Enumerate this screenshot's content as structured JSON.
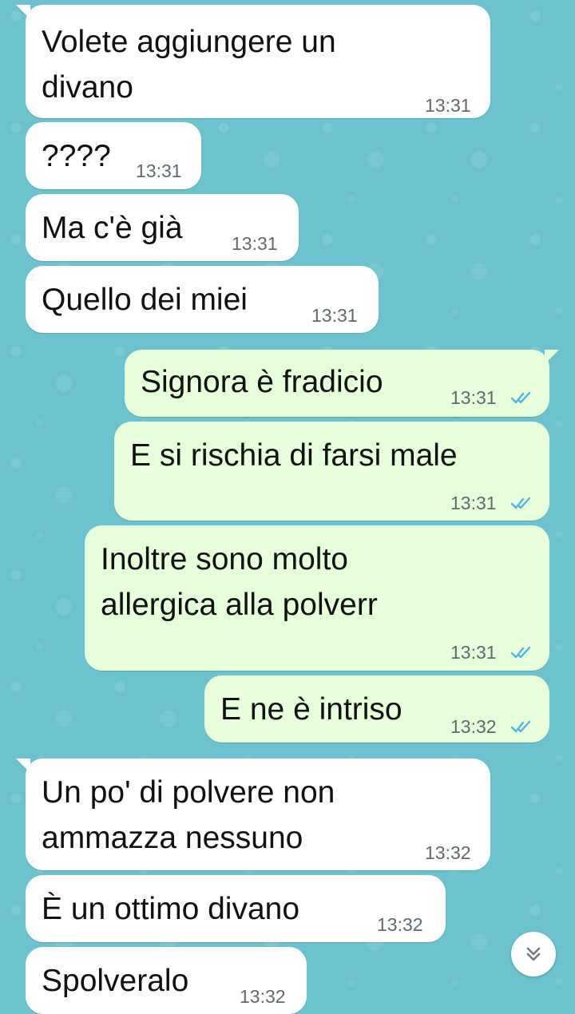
{
  "colors": {
    "wallpaper": "#6cc3cf",
    "incoming_bubble": "#ffffff",
    "outgoing_bubble": "#e7ffdb",
    "read_ticks": "#4fb6ec",
    "timestamp": "#5f6a6e"
  },
  "messages": [
    {
      "text": "Volete aggiungere un\ndivano",
      "time": "13:31",
      "direction": "incoming"
    },
    {
      "text": "????",
      "time": "13:31",
      "direction": "incoming"
    },
    {
      "text": "Ma c'è già",
      "time": "13:31",
      "direction": "incoming"
    },
    {
      "text": "Quello dei miei",
      "time": "13:31",
      "direction": "incoming"
    },
    {
      "text": "Signora è fradicio",
      "time": "13:31",
      "direction": "outgoing",
      "status": "read"
    },
    {
      "text": "E si rischia di farsi male",
      "time": "13:31",
      "direction": "outgoing",
      "status": "read"
    },
    {
      "text": "Inoltre sono molto\nallergica alla polverr",
      "time": "13:31",
      "direction": "outgoing",
      "status": "read"
    },
    {
      "text": "E ne è intriso",
      "time": "13:32",
      "direction": "outgoing",
      "status": "read"
    },
    {
      "text": "Un po' di polvere non\nammazza nessuno",
      "time": "13:32",
      "direction": "incoming"
    },
    {
      "text": "È un ottimo divano",
      "time": "13:32",
      "direction": "incoming"
    },
    {
      "text": "Spolveralo",
      "time": "13:32",
      "direction": "incoming"
    }
  ],
  "scroll_button": {
    "icon": "double-chevron-down-icon"
  }
}
